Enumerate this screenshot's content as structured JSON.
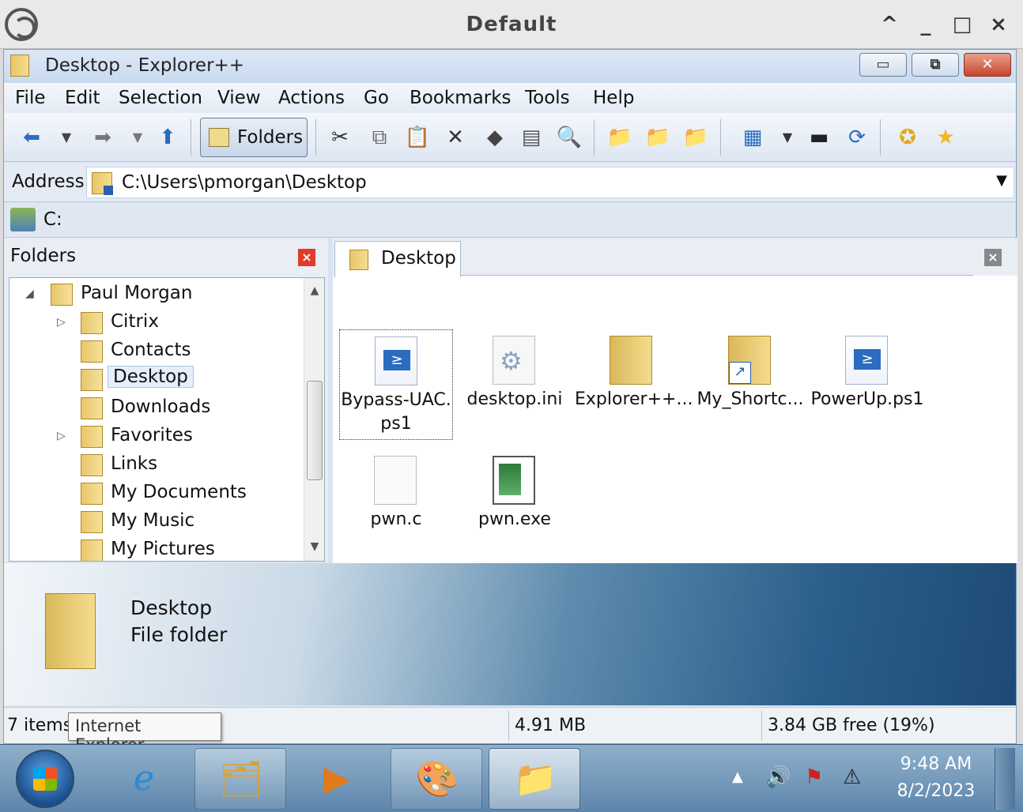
{
  "outer_window": {
    "title": "Default",
    "controls": [
      "^",
      "_",
      "□",
      "×"
    ]
  },
  "window": {
    "title": "Desktop - Explorer++",
    "controls": {
      "minimize": "▭",
      "restore": "⧉",
      "close": "✕"
    }
  },
  "menu": [
    "File",
    "Edit",
    "Selection",
    "View",
    "Actions",
    "Go",
    "Bookmarks",
    "Tools",
    "Help"
  ],
  "toolbar": {
    "folders_label": "Folders",
    "icons": [
      "back-arrow-icon",
      "dropdown-icon",
      "forward-arrow-icon",
      "dropdown-icon",
      "up-arrow-icon",
      "cut-icon",
      "copy-icon",
      "paste-icon",
      "delete-icon",
      "properties-icon",
      "list-icon",
      "search-icon",
      "new-folder-icon",
      "copy-to-icon",
      "move-to-icon",
      "views-icon",
      "dropdown-icon",
      "command-prompt-icon",
      "refresh-icon",
      "add-bookmark-icon",
      "bookmarks-icon"
    ]
  },
  "address": {
    "label": "Address",
    "value": "C:\\Users\\pmorgan\\Desktop"
  },
  "drive": {
    "label": "C:"
  },
  "folders_panel": {
    "title": "Folders",
    "close": "×",
    "items": [
      {
        "label": "Paul Morgan",
        "level": 0,
        "expander": "◢"
      },
      {
        "label": "Citrix",
        "level": 1,
        "expander": "▷"
      },
      {
        "label": "Contacts",
        "level": 1,
        "expander": ""
      },
      {
        "label": "Desktop",
        "level": 1,
        "expander": "",
        "selected": true
      },
      {
        "label": "Downloads",
        "level": 1,
        "expander": ""
      },
      {
        "label": "Favorites",
        "level": 1,
        "expander": "▷"
      },
      {
        "label": "Links",
        "level": 1,
        "expander": ""
      },
      {
        "label": "My Documents",
        "level": 1,
        "expander": ""
      },
      {
        "label": "My Music",
        "level": 1,
        "expander": ""
      },
      {
        "label": "My Pictures",
        "level": 1,
        "expander": ""
      }
    ]
  },
  "tab": {
    "label": "Desktop",
    "close": "×"
  },
  "files": [
    {
      "name": "Bypass-UAC.\nps1",
      "type": "ps1",
      "focused": true
    },
    {
      "name": "desktop.ini",
      "type": "ini"
    },
    {
      "name": "Explorer++...",
      "type": "folder"
    },
    {
      "name": "My_Shortc...",
      "type": "shortcut"
    },
    {
      "name": "PowerUp.ps1",
      "type": "ps1"
    },
    {
      "name": "pwn.c",
      "type": "blank"
    },
    {
      "name": "pwn.exe",
      "type": "exe"
    }
  ],
  "preview": {
    "title": "Desktop",
    "type": "File folder"
  },
  "status": {
    "items": "7 items",
    "size": "4.91 MB",
    "free": "3.84 GB free (19%)"
  },
  "tooltip": "Internet Explorer",
  "taskbar": {
    "clock_time": "9:48 AM",
    "clock_date": "8/2/2023"
  }
}
